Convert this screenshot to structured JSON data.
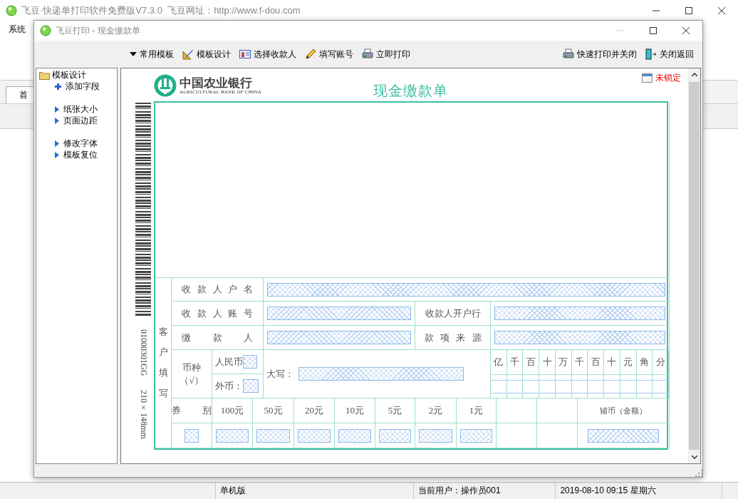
{
  "main_window": {
    "title": "飞豆·快递单打印软件免费版V7.3.0  飞豆网址：http://www.f-dou.com",
    "menu": [
      "系统"
    ],
    "tabs": [
      "首"
    ]
  },
  "dialog": {
    "title": "飞豆打印 - 现金缴款单",
    "toolbar_left": [
      "常用模板",
      "模板设计",
      "选择收款人",
      "填写账号",
      "立即打印"
    ],
    "toolbar_right": [
      "快速打印并关闭",
      "关闭返回"
    ],
    "tree": {
      "label": "模板设计",
      "children": [
        {
          "kind": "add",
          "label": "添加字段"
        },
        {
          "kind": "spacer"
        },
        {
          "kind": "action",
          "label": "纸张大小"
        },
        {
          "kind": "action",
          "label": "页面边距"
        },
        {
          "kind": "spacer"
        },
        {
          "kind": "action",
          "label": "修改字体"
        },
        {
          "kind": "action",
          "label": "模板复位"
        }
      ]
    },
    "lock_status": "未锁定",
    "form": {
      "bank_name": "中国农业银行",
      "bank_name_en": "AGRICULTURAL BANK OF CHINA",
      "title": "现金缴款单",
      "serial": "01000301GG",
      "paper_size": "210×148mm",
      "side_label": "客户填写",
      "payee_name_label": "收 款 人 户 名",
      "payee_account_label": "收 款 人 账 号",
      "payee_bank_label": "收款人开户行",
      "payer_label": "缴 款 人",
      "source_label": "款 项 来 源",
      "currency_label": "币种",
      "currency_mark": "（√）",
      "rmb_label": "人民币",
      "foreign_label": "外币：",
      "amount_words_label": "大写：",
      "digit_headers": [
        "亿",
        "千",
        "百",
        "十",
        "万",
        "千",
        "百",
        "十",
        "元",
        "角",
        "分"
      ],
      "denomination_label": "券 别",
      "denominations": [
        "100元",
        "50元",
        "20元",
        "10元",
        "5元",
        "2元",
        "1元"
      ],
      "coin_label": "辅币（金额）"
    }
  },
  "status_bar": [
    "单机版",
    "当前用户：操作员001",
    "2019-08-10 09:15 星期六"
  ]
}
